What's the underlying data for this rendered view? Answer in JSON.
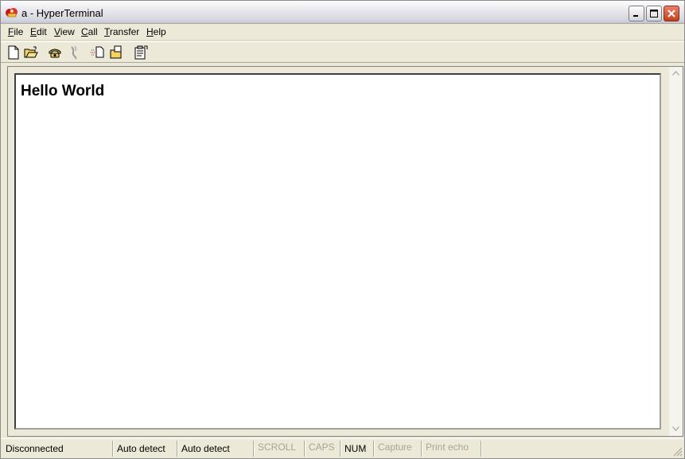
{
  "window": {
    "title": "a - HyperTerminal"
  },
  "menu": [
    {
      "label": "File",
      "key": "F",
      "rest": "ile"
    },
    {
      "label": "Edit",
      "key": "E",
      "rest": "dit"
    },
    {
      "label": "View",
      "key": "V",
      "rest": "iew"
    },
    {
      "label": "Call",
      "key": "C",
      "rest": "all"
    },
    {
      "label": "Transfer",
      "key": "T",
      "rest": "ransfer"
    },
    {
      "label": "Help",
      "key": "H",
      "rest": "elp"
    }
  ],
  "toolbar": {
    "icons": [
      "new-icon",
      "open-icon",
      "call-icon",
      "disconnect-icon",
      "send-icon",
      "receive-icon",
      "properties-icon"
    ]
  },
  "terminal": {
    "text": "Hello World"
  },
  "status": {
    "connection": "Disconnected",
    "emulation": "Auto detect",
    "port_settings": "Auto detect",
    "scroll": "SCROLL",
    "caps": "CAPS",
    "num": "NUM",
    "capture": "Capture",
    "print_echo": "Print echo"
  }
}
